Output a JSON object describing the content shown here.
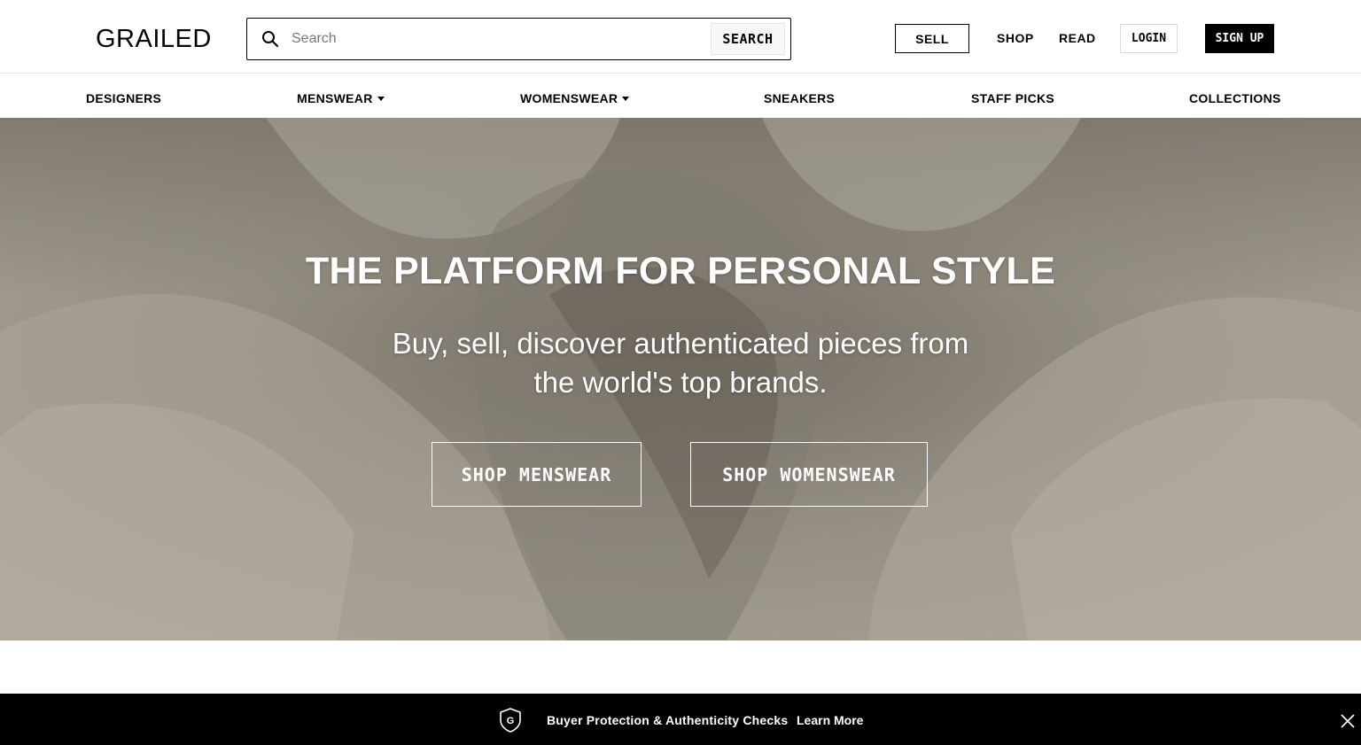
{
  "header": {
    "logo": "GRAILED",
    "search": {
      "placeholder": "Search",
      "value": "",
      "button_label": "SEARCH"
    },
    "sell_label": "SELL",
    "shop_label": "SHOP",
    "read_label": "READ",
    "login_label": "LOGIN",
    "signup_label": "SIGN UP"
  },
  "category_nav": {
    "items": [
      {
        "label": "DESIGNERS",
        "has_dropdown": false
      },
      {
        "label": "MENSWEAR",
        "has_dropdown": true
      },
      {
        "label": "WOMENSWEAR",
        "has_dropdown": true
      },
      {
        "label": "SNEAKERS",
        "has_dropdown": false
      },
      {
        "label": "STAFF PICKS",
        "has_dropdown": false
      },
      {
        "label": "COLLECTIONS",
        "has_dropdown": false
      }
    ]
  },
  "hero": {
    "title": "THE PLATFORM FOR PERSONAL STYLE",
    "subtitle": "Buy, sell, discover authenticated pieces from the world's top brands.",
    "buttons": [
      {
        "label": "SHOP MENSWEAR"
      },
      {
        "label": "SHOP WOMENSWEAR"
      }
    ]
  },
  "banner": {
    "shield_letter": "G",
    "text": "Buyer Protection & Authenticity Checks",
    "link_label": "Learn More"
  },
  "colors": {
    "header_bg": "#ffffff",
    "text": "#000000",
    "banner_bg": "#000000",
    "hero_text": "#ffffff"
  },
  "icons": [
    "search-icon",
    "caret-down-icon",
    "shield-icon",
    "close-icon"
  ]
}
